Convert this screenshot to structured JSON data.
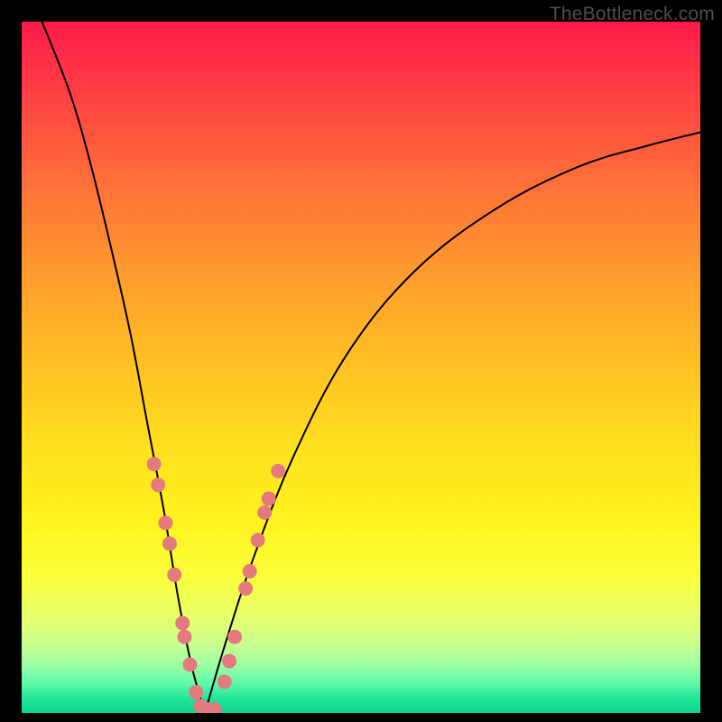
{
  "watermark": "TheBottleneck.com",
  "colors": {
    "dot": "#e47a7d",
    "curve": "#000000",
    "bg_top": "#ff1a4a",
    "bg_bottom": "#0fd58f"
  },
  "chart_data": {
    "type": "line",
    "title": "",
    "xlabel": "",
    "ylabel": "",
    "xlim": [
      0,
      100
    ],
    "ylim": [
      0,
      100
    ],
    "grid": false,
    "curve": {
      "name": "bottleneck-curve",
      "minimum_x": 27,
      "left_branch": [
        {
          "x": 3,
          "y": 100
        },
        {
          "x": 7,
          "y": 90
        },
        {
          "x": 10,
          "y": 80
        },
        {
          "x": 13,
          "y": 68
        },
        {
          "x": 16,
          "y": 55
        },
        {
          "x": 18.5,
          "y": 42
        },
        {
          "x": 21,
          "y": 29
        },
        {
          "x": 23,
          "y": 17
        },
        {
          "x": 25,
          "y": 7
        },
        {
          "x": 27,
          "y": 0
        }
      ],
      "right_branch": [
        {
          "x": 27,
          "y": 0
        },
        {
          "x": 30,
          "y": 10
        },
        {
          "x": 34,
          "y": 22
        },
        {
          "x": 40,
          "y": 37
        },
        {
          "x": 48,
          "y": 52
        },
        {
          "x": 58,
          "y": 64
        },
        {
          "x": 70,
          "y": 73
        },
        {
          "x": 82,
          "y": 79
        },
        {
          "x": 92,
          "y": 82
        },
        {
          "x": 100,
          "y": 84
        }
      ]
    },
    "markers": [
      {
        "x": 19.5,
        "y": 36
      },
      {
        "x": 20.1,
        "y": 33
      },
      {
        "x": 21.2,
        "y": 27.5
      },
      {
        "x": 21.8,
        "y": 24.5
      },
      {
        "x": 22.5,
        "y": 20
      },
      {
        "x": 23.7,
        "y": 13
      },
      {
        "x": 24.0,
        "y": 11
      },
      {
        "x": 24.8,
        "y": 7
      },
      {
        "x": 25.7,
        "y": 3
      },
      {
        "x": 26.4,
        "y": 1
      },
      {
        "x": 27.4,
        "y": 0.5
      },
      {
        "x": 28.4,
        "y": 0.5
      },
      {
        "x": 29.9,
        "y": 4.5
      },
      {
        "x": 30.6,
        "y": 7.5
      },
      {
        "x": 31.4,
        "y": 11
      },
      {
        "x": 33.0,
        "y": 18
      },
      {
        "x": 33.6,
        "y": 20.5
      },
      {
        "x": 34.8,
        "y": 25
      },
      {
        "x": 35.8,
        "y": 29
      },
      {
        "x": 36.4,
        "y": 31
      },
      {
        "x": 37.8,
        "y": 35
      }
    ],
    "marker_radius_px": 8
  }
}
